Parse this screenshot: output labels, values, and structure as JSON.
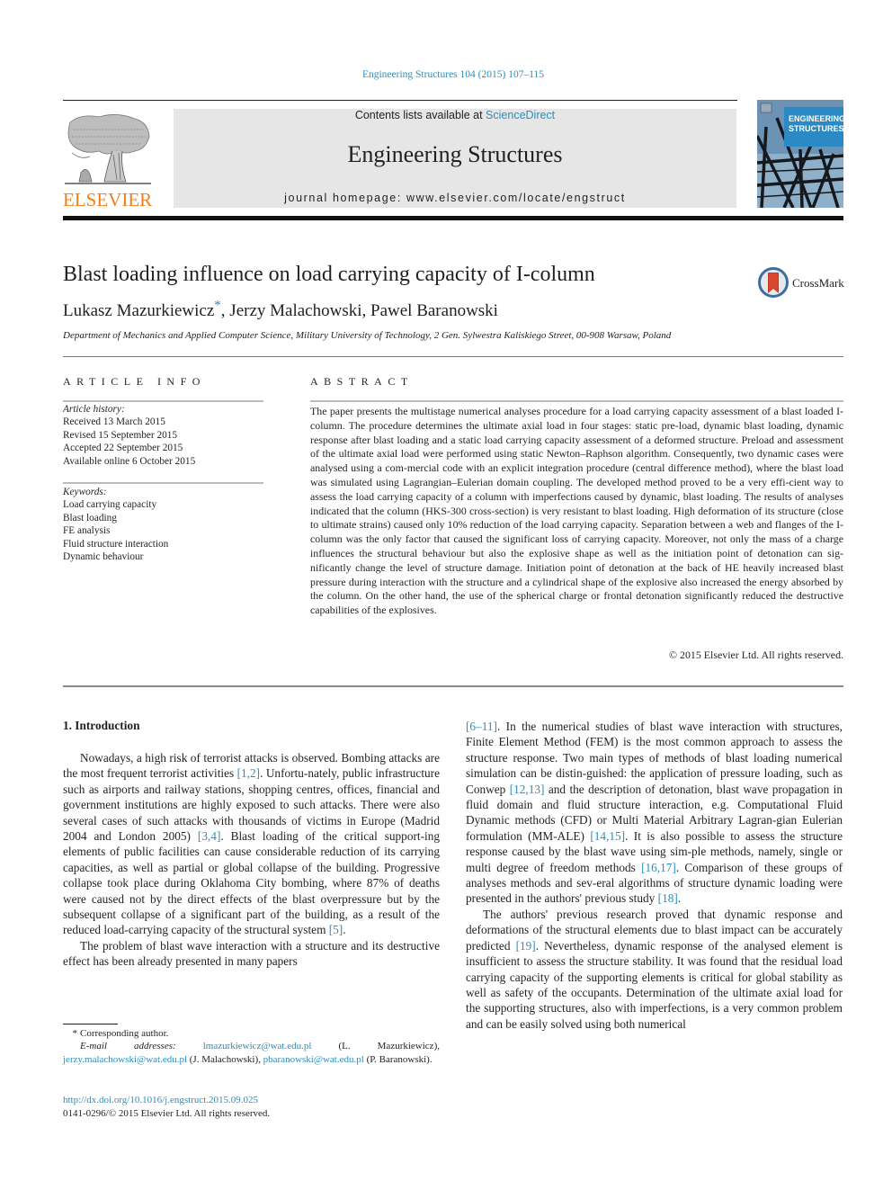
{
  "header": {
    "journal_reference": "Engineering Structures 104 (2015) 107–115",
    "contents_prefix": "Contents lists available at ",
    "contents_link": "ScienceDirect",
    "journal_title": "Engineering Structures",
    "homepage_prefix": "journal homepage: ",
    "homepage_url": "www.elsevier.com/locate/engstruct",
    "publisher_logo_text": "ELSEVIER",
    "cover_title_line1": "ENGINEERING",
    "cover_title_line2": "STRUCTURES",
    "colors": {
      "link": "#2a8fbd",
      "elsevier_orange": "#f07f1a",
      "masthead_bg": "#e6e6e6"
    }
  },
  "article": {
    "title": "Blast loading influence on load carrying capacity of I-column",
    "crossmark_label": "CrossMark",
    "authors": [
      {
        "name": "Lukasz Mazurkiewicz",
        "corresponding_mark": "*",
        "separator": ", "
      },
      {
        "name": "Jerzy Malachowski",
        "separator": ", "
      },
      {
        "name": "Pawel Baranowski",
        "separator": ""
      }
    ],
    "affiliation": "Department of Mechanics and Applied Computer Science, Military University of Technology, 2 Gen. Sylwestra Kaliskiego Street, 00-908 Warsaw, Poland"
  },
  "article_info": {
    "heading": "ARTICLE INFO",
    "history_label": "Article history:",
    "history": [
      "Received 13 March 2015",
      "Revised 15 September 2015",
      "Accepted 22 September 2015",
      "Available online 6 October 2015"
    ],
    "keywords_label": "Keywords:",
    "keywords": [
      "Load carrying capacity",
      "Blast loading",
      "FE analysis",
      "Fluid structure interaction",
      "Dynamic behaviour"
    ]
  },
  "abstract": {
    "heading": "ABSTRACT",
    "text": "The paper presents the multistage numerical analyses procedure for a load carrying capacity assessment of a blast loaded I-column. The procedure determines the ultimate axial load in four stages: static pre-load, dynamic blast loading, dynamic response after blast loading and a static load carrying capacity assessment of a deformed structure. Preload and assessment of the ultimate axial load were performed using static Newton–Raphson algorithm. Consequently, two dynamic cases were analysed using a com-mercial code with an explicit integration procedure (central difference method), where the blast load was simulated using Lagrangian–Eulerian domain coupling. The developed method proved to be a very effi-cient way to assess the load carrying capacity of a column with imperfections caused by dynamic, blast loading. The results of analyses indicated that the column (HKS-300 cross-section) is very resistant to blast loading. High deformation of its structure (close to ultimate strains) caused only 10% reduction of the load carrying capacity. Separation between a web and flanges of the I-column was the only factor that caused the significant loss of carrying capacity. Moreover, not only the mass of a charge influences the structural behaviour but also the explosive shape as well as the initiation point of detonation can sig-nificantly change the level of structure damage. Initiation point of detonation at the back of HE heavily increased blast pressure during interaction with the structure and a cylindrical shape of the explosive also increased the energy absorbed by the column. On the other hand, the use of the spherical charge or frontal detonation significantly reduced the destructive capabilities of the explosives.",
    "copyright": "© 2015 Elsevier Ltd. All rights reserved."
  },
  "body": {
    "section_heading": "1. Introduction",
    "left_paragraphs": [
      {
        "parts": [
          {
            "t": "Nowadays, a high risk of terrorist attacks is observed. Bombing attacks are the most frequent terrorist activities "
          },
          {
            "ref": "[1,2]"
          },
          {
            "t": ". Unfortu-nately, public infrastructure such as airports and railway stations, shopping centres, offices, financial and government institutions are highly exposed to such attacks. There were also several cases of such attacks with thousands of victims in Europe (Madrid 2004 and London 2005) "
          },
          {
            "ref": "[3,4]"
          },
          {
            "t": ". Blast loading of the critical support-ing elements of public facilities can cause considerable reduction of its carrying capacities, as well as partial or global collapse of the building. Progressive collapse took place during Oklahoma City bombing, where 87% of deaths were caused not by the direct effects of the blast overpressure but by the subsequent collapse of a significant part of the building, as a result of the reduced load-carrying capacity of the structural system "
          },
          {
            "ref": "[5]"
          },
          {
            "t": "."
          }
        ]
      },
      {
        "parts": [
          {
            "t": "The problem of blast wave interaction with a structure and its destructive effect has been already presented in many papers"
          }
        ]
      }
    ],
    "right_paragraphs": [
      {
        "noindent": true,
        "parts": [
          {
            "ref": "[6–11]"
          },
          {
            "t": ". In the numerical studies of blast wave interaction with structures, Finite Element Method (FEM) is the most common approach to assess the structure response. Two main types of methods of blast loading numerical simulation can be distin-guished: the application of pressure loading, such as Conwep "
          },
          {
            "ref": "[12,13]"
          },
          {
            "t": " and the description of detonation, blast wave propagation in fluid domain and fluid structure interaction, e.g. Computational Fluid Dynamic methods (CFD) or Multi Material Arbitrary Lagran-gian Eulerian formulation (MM-ALE) "
          },
          {
            "ref": "[14,15]"
          },
          {
            "t": ". It is also possible to assess the structure response caused by the blast wave using sim-ple methods, namely, single or multi degree of freedom methods "
          },
          {
            "ref": "[16,17]"
          },
          {
            "t": ". Comparison of these groups of analyses methods and sev-eral algorithms of structure dynamic loading were presented in the authors' previous study "
          },
          {
            "ref": "[18]"
          },
          {
            "t": "."
          }
        ]
      },
      {
        "parts": [
          {
            "t": "The authors' previous research proved that dynamic response and deformations of the structural elements due to blast impact can be accurately predicted "
          },
          {
            "ref": "[19]"
          },
          {
            "t": ". Nevertheless, dynamic response of the analysed element is insufficient to assess the structure stability. It was found that the residual load carrying capacity of the supporting elements is critical for global stability as well as safety of the occupants. Determination of the ultimate axial load for the supporting structures, also with imperfections, is a very common problem and can be easily solved using both numerical"
          }
        ]
      }
    ]
  },
  "footnotes": {
    "star": "*",
    "corresponding": "Corresponding author.",
    "email_label": "E-mail addresses:",
    "emails": [
      {
        "address": "lmazurkiewicz@wat.edu.pl",
        "owner": " (L. Mazurkiewicz), "
      },
      {
        "address": "jerzy.malachowski@wat.edu.pl",
        "owner": " (J. Malachowski), "
      },
      {
        "address": "pbaranowski@wat.edu.pl",
        "owner": " (P. Baranowski)."
      }
    ],
    "doi": "http://dx.doi.org/10.1016/j.engstruct.2015.09.025",
    "issn_copyright": "0141-0296/© 2015 Elsevier Ltd. All rights reserved."
  }
}
